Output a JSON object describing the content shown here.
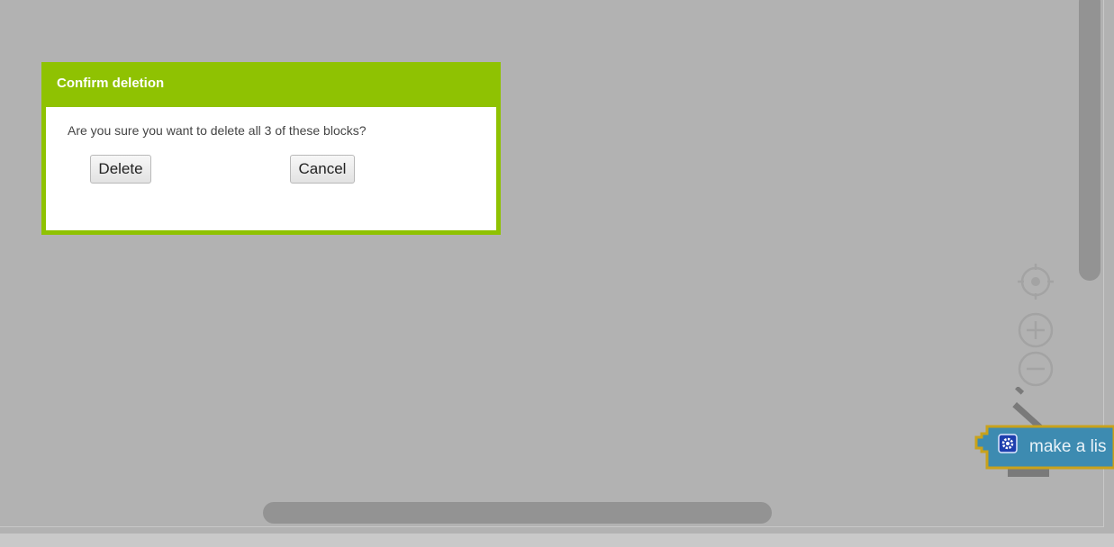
{
  "dialog": {
    "title": "Confirm deletion",
    "message": "Are you sure you want to delete all 3 of these blocks?",
    "delete_label": "Delete",
    "cancel_label": "Cancel"
  },
  "workspace_controls": {
    "icons": [
      "recenter-icon",
      "zoom-in-icon",
      "zoom-out-icon",
      "trash-icon"
    ]
  },
  "block": {
    "label": "make a lis",
    "icon": "gear-icon",
    "color": "#3d8bb1",
    "outline": "#c8a21c"
  },
  "colors": {
    "workspace": "#b2b2b2",
    "dialog_accent": "#8fc202"
  }
}
